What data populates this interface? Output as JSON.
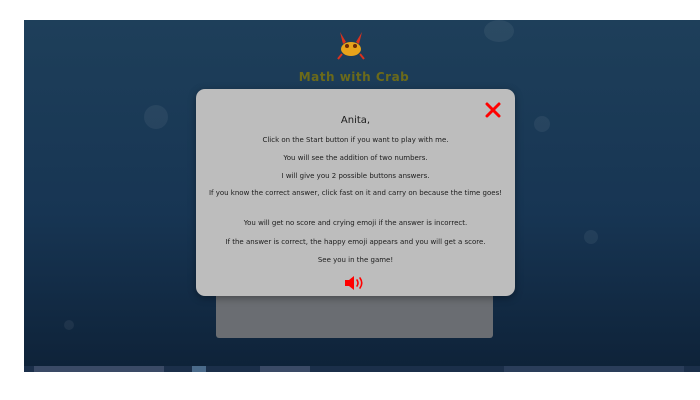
{
  "app": {
    "title": "Math with Crab"
  },
  "modal": {
    "greeting": "Anita,",
    "lines": [
      "Click on the Start button if you want to play with me.",
      "You will see the addition of two numbers.",
      "I will give you 2 possible buttons answers.",
      "If you know the correct answer, click fast on it and carry on because the time goes!",
      "You will get no score and crying emoji if the answer is incorrect.",
      "If the answer is correct, the happy emoji appears and you will get a score.",
      "See you in the game!"
    ],
    "close_icon": "close-icon",
    "sound_icon": "speaker-icon"
  },
  "colors": {
    "accent": "#ff0000",
    "modal_bg": "#bdbdbd",
    "screen_bg": "#173553"
  }
}
